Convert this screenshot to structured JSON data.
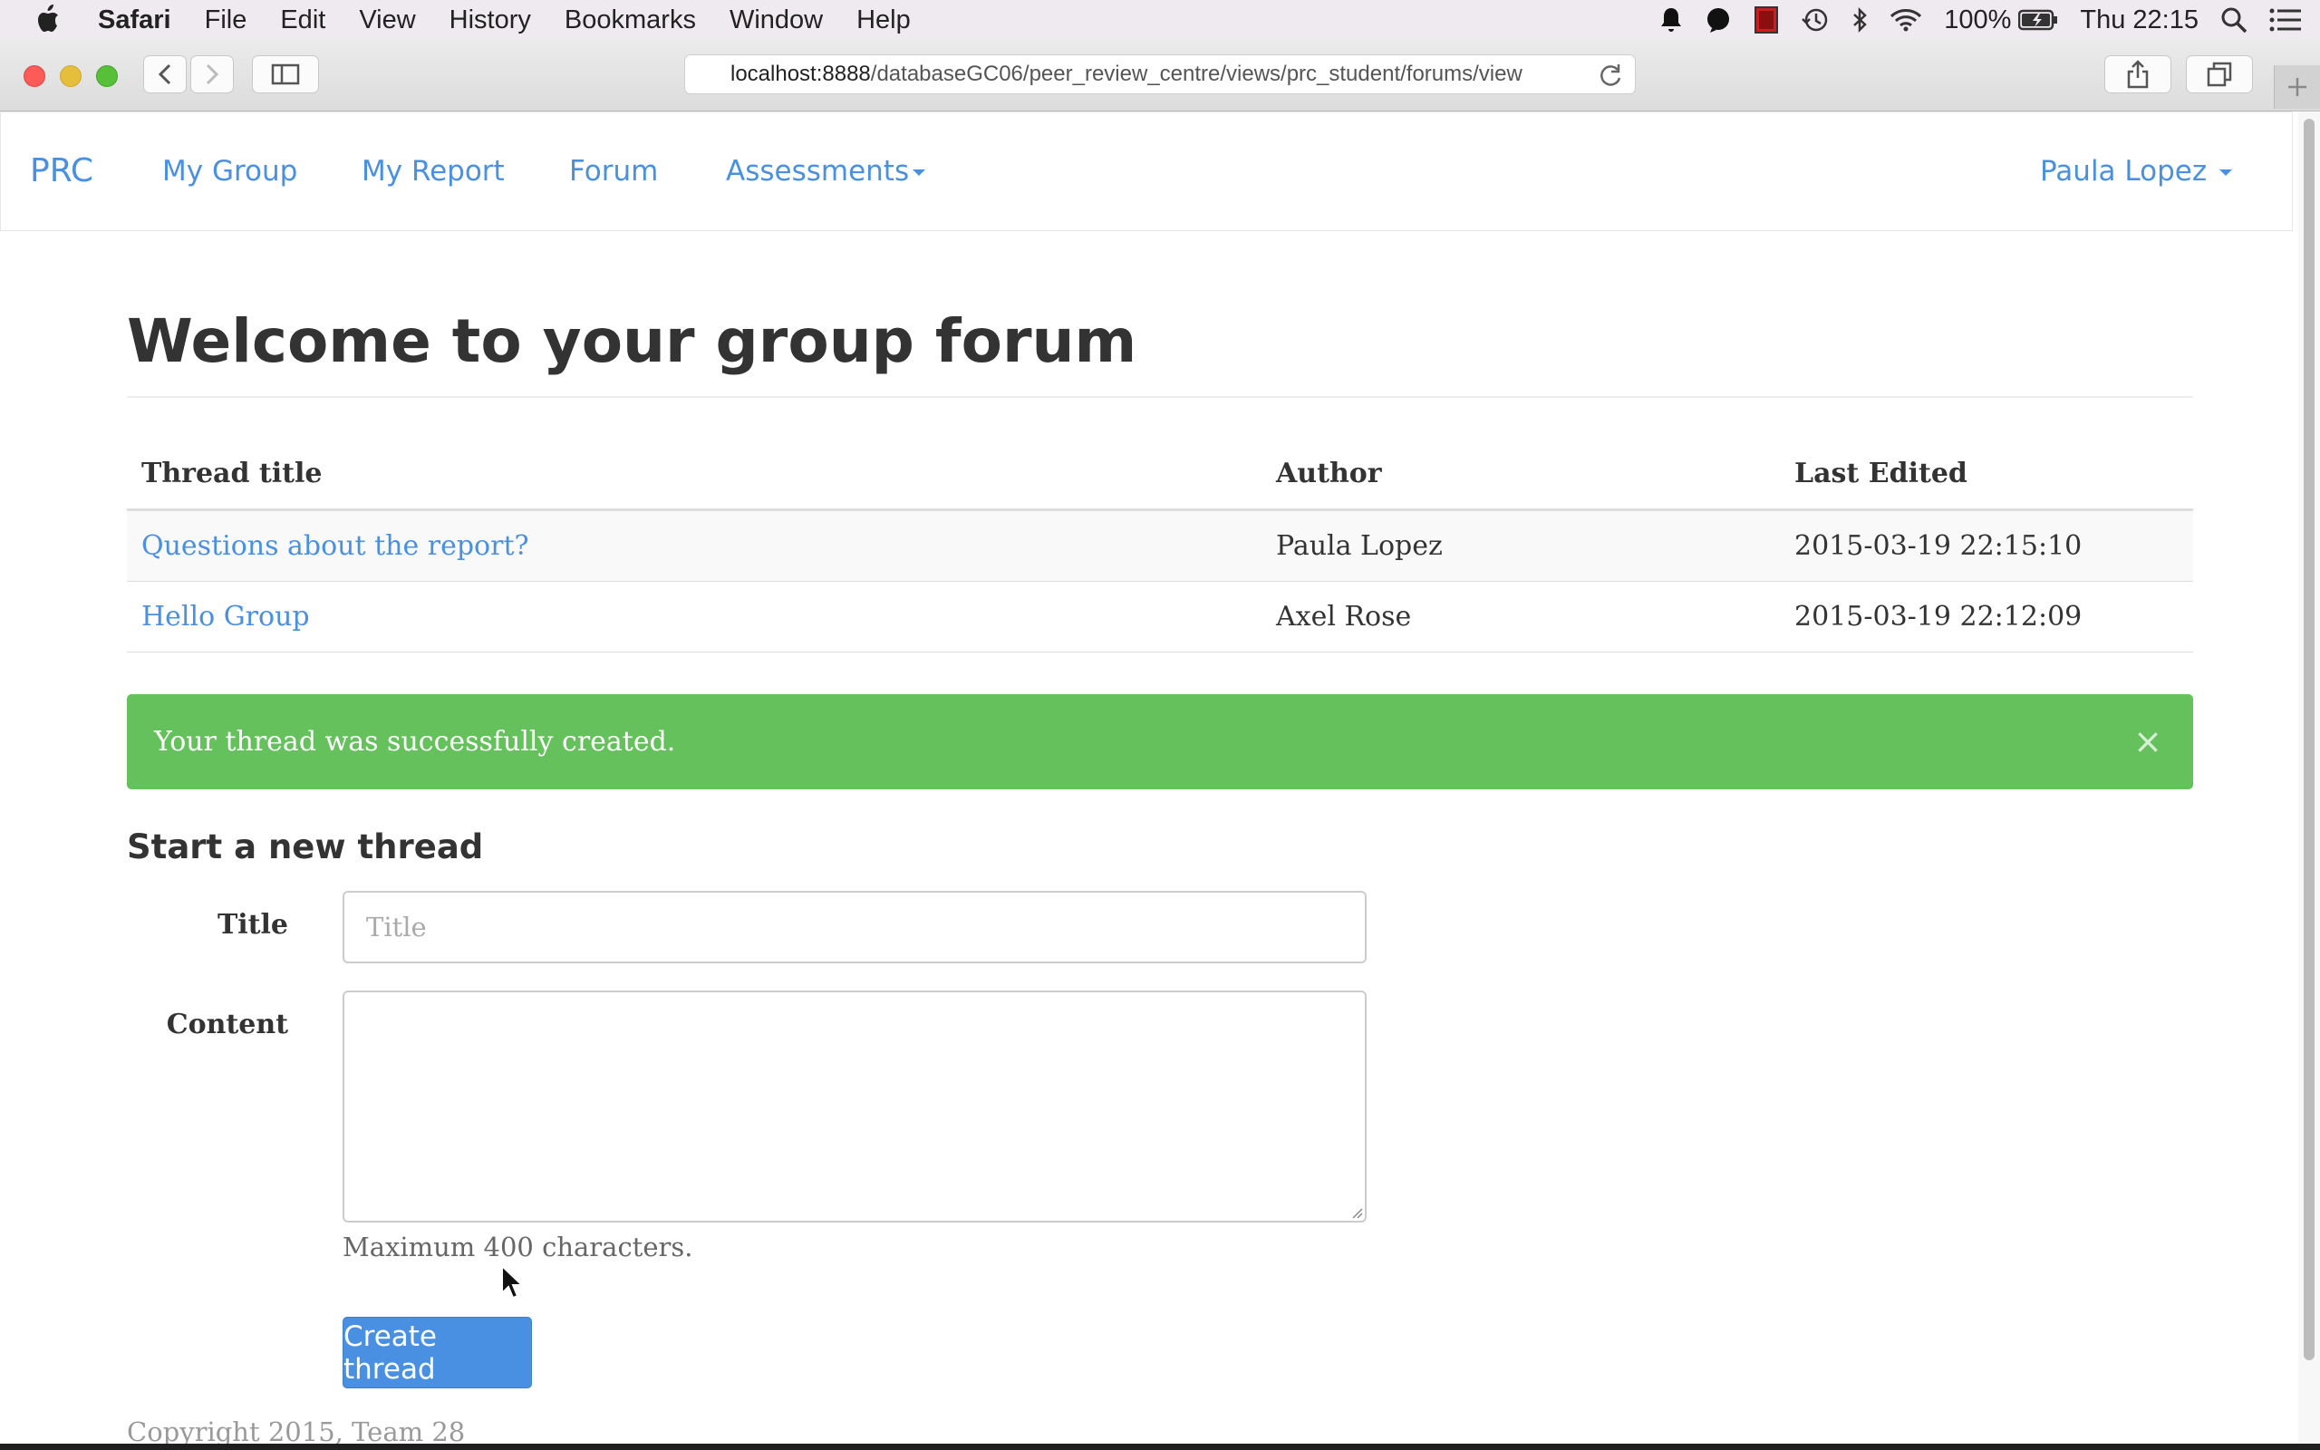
{
  "menubar": {
    "app": "Safari",
    "items": [
      "File",
      "Edit",
      "View",
      "History",
      "Bookmarks",
      "Window",
      "Help"
    ],
    "battery": "100%",
    "clock": "Thu 22:15"
  },
  "browser": {
    "url_host": "localhost:8888",
    "url_path": "/databaseGC06/peer_review_centre/views/prc_student/forums/view"
  },
  "navbar": {
    "brand": "PRC",
    "links": [
      "My Group",
      "My Report",
      "Forum",
      "Assessments"
    ],
    "user": "Paula Lopez"
  },
  "page": {
    "heading": "Welcome to your group forum",
    "table": {
      "headers": [
        "Thread title",
        "Author",
        "Last Edited"
      ],
      "rows": [
        {
          "title": "Questions about the report?",
          "author": "Paula Lopez",
          "edited": "2015-03-19 22:15:10"
        },
        {
          "title": "Hello Group",
          "author": "Axel Rose",
          "edited": "2015-03-19 22:12:09"
        }
      ]
    },
    "alert": {
      "message": "Your thread was successfully created.",
      "close": "×"
    },
    "form": {
      "heading": "Start a new thread",
      "title_label": "Title",
      "title_placeholder": "Title",
      "content_label": "Content",
      "help": "Maximum 400 characters.",
      "submit": "Create thread"
    },
    "footer": "Copyright 2015, Team 28"
  },
  "colors": {
    "link": "#4a90e2",
    "alert_success": "#65c15c",
    "button_primary": "#4a90e2"
  }
}
